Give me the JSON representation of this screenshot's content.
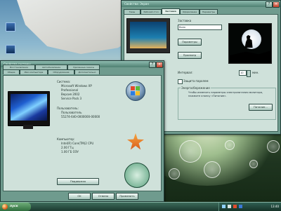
{
  "desktop": {
    "icons": [
      {
        "label": ""
      },
      {
        "label": ""
      }
    ]
  },
  "screensaver_window": {
    "title": "Свойства: Экран",
    "tabs": [
      "Темы",
      "Рабочий стол",
      "Заставка",
      "Оформление",
      "Параметры"
    ],
    "active_tab_index": 2,
    "screensaver_label": "Заставка",
    "screensaver_value": "Волк",
    "settings_button": "Параметры",
    "preview_button": "Просмотр",
    "interval_label": "Интервал:",
    "interval_value": "10",
    "interval_unit": "мин.",
    "password_label": "Защита паролем",
    "power_label": "Энергосбережение",
    "power_text": "Чтобы изменить параметры электропитания монитора, нажмите кнопку «Питание».",
    "power_button": "Питание..."
  },
  "system_window": {
    "title": "Свойства системы",
    "tabs": [
      "Общие",
      "Имя компьютера",
      "Оборудование",
      "Дополнительно",
      "Восстановление",
      "Автообновление",
      "Удаленные сеансы"
    ],
    "active_tab_index": 0,
    "system_label": "Система:",
    "system_lines": [
      "Microsoft Windows XP",
      "Professional",
      "Версия 2002",
      "Service Pack 3"
    ],
    "registered_label": "Пользователь:",
    "registered_lines": [
      "Пользователь",
      "55274-640-0000000-00000"
    ],
    "computer_label": "Компьютер:",
    "computer_lines": [
      "Intel(R) Core(TM)2 CPU",
      "2.00 ГГц",
      "1.00 ГБ ОЗУ"
    ],
    "support_button": "Поддержка",
    "ok_button": "OK",
    "cancel_button": "Отмена",
    "apply_button": "Применить"
  },
  "taskbar": {
    "start_label": "пуск",
    "clock": "13:40",
    "tray_icons": [
      "network-icon",
      "volume-icon",
      "security-icon",
      "language-icon"
    ]
  }
}
